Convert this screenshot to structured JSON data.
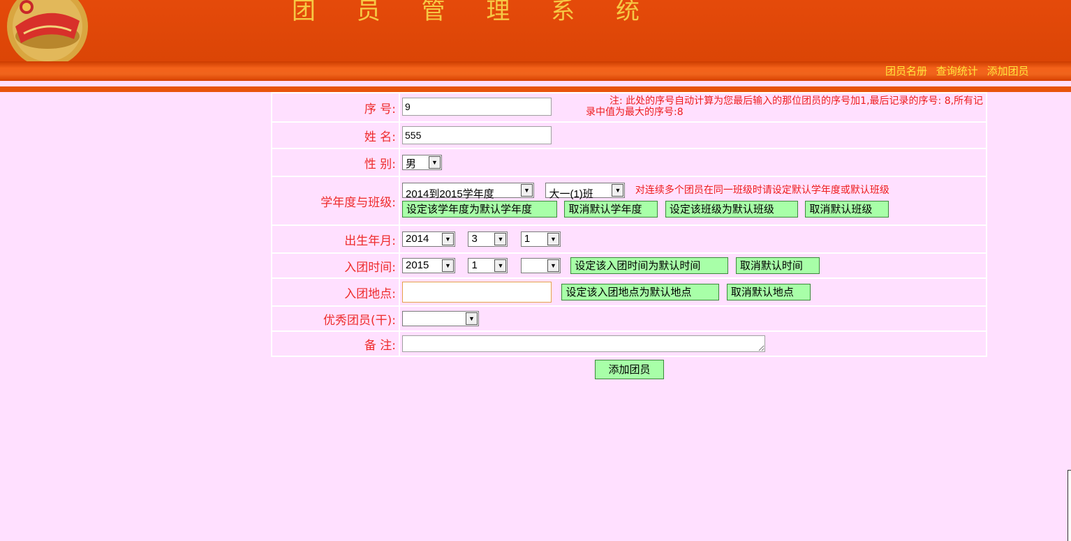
{
  "header": {
    "title": "团 员 管 理 系 统",
    "nav": [
      "团员名册",
      "查询统计",
      "添加团员"
    ]
  },
  "form": {
    "serial": {
      "label": "序 号:",
      "value": "9",
      "note": "注: 此处的序号自动计算为您最后输入的那位团员的序号加1,最后记录的序号: 8,所有记录中值为最大的序号:8"
    },
    "name": {
      "label": "姓 名:",
      "value": "555"
    },
    "gender": {
      "label": "性 别:",
      "value": "男"
    },
    "year_class": {
      "label": "学年度与班级:",
      "year": "2014到2015学年度",
      "class": "大一(1)班",
      "hint": "对连续多个团员在同一班级时请设定默认学年度或默认班级",
      "btn_set_year": "设定该学年度为默认学年度",
      "btn_cancel_year": "取消默认学年度",
      "btn_set_class": "设定该班级为默认班级",
      "btn_cancel_class": "取消默认班级"
    },
    "birth": {
      "label": "出生年月:",
      "year": "2014",
      "month": "3",
      "day": "1"
    },
    "join_time": {
      "label": "入团时间:",
      "year": "2015",
      "month": "1",
      "day": "",
      "btn_set": "设定该入团时间为默认时间",
      "btn_cancel": "取消默认时间"
    },
    "join_place": {
      "label": "入团地点:",
      "value": "",
      "btn_set": "设定该入团地点为默认地点",
      "btn_cancel": "取消默认地点"
    },
    "excellent": {
      "label": "优秀团员(干):",
      "value": ""
    },
    "remark": {
      "label": "备 注:",
      "value": ""
    },
    "submit": "添加团员"
  },
  "colors": {
    "header": "#e04806",
    "title": "#f6c844",
    "page_bg": "#ffe0ff",
    "button_bg": "#a8ffa8",
    "label": "#ee2b2b"
  }
}
